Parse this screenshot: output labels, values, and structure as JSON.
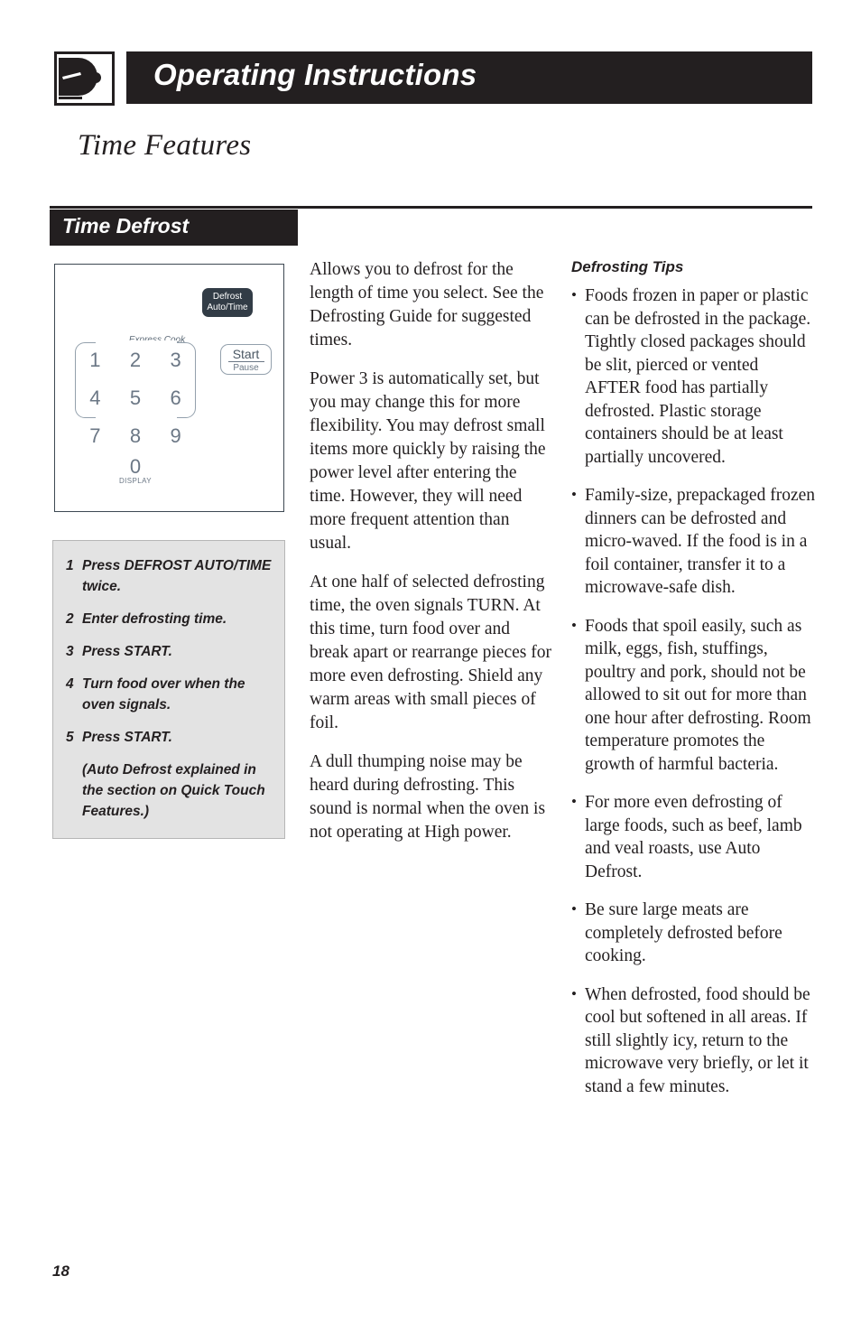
{
  "header": {
    "icon": "microwave-door-icon",
    "title": "Operating Instructions"
  },
  "page_heading": "Time Features",
  "section": {
    "label": "Time Defrost"
  },
  "control_panel": {
    "defrost_key": {
      "line1": "Defrost",
      "line2": "Auto/Time"
    },
    "express_cook_label": "Express Cook",
    "keypad_rows": [
      [
        "1",
        "2",
        "3"
      ],
      [
        "4",
        "5",
        "6"
      ],
      [
        "7",
        "8",
        "9"
      ]
    ],
    "zero_key": "0",
    "display_label": "DISPLAY",
    "start_key": {
      "line1": "Start",
      "line2": "Pause"
    }
  },
  "steps": [
    {
      "num": "1",
      "text": "Press DEFROST AUTO/TIME twice."
    },
    {
      "num": "2",
      "text": "Enter defrosting time."
    },
    {
      "num": "3",
      "text": "Press START."
    },
    {
      "num": "4",
      "text": "Turn food over when the oven signals."
    },
    {
      "num": "5",
      "text": "Press START."
    }
  ],
  "steps_note": "(Auto Defrost explained in the section on Quick Touch Features.)",
  "body_paragraphs": [
    "Allows you to defrost for the length of time you select. See the Defrosting Guide for suggested times.",
    "Power 3 is automatically set, but you may change this for more flexibility. You may defrost small items more quickly by raising the power level after entering the time. However, they will need more frequent attention than usual.",
    "At one half of selected defrosting time, the oven signals TURN. At this time, turn food over and break apart or rearrange pieces for more even defrosting. Shield any warm areas with small pieces of foil.",
    "A dull thumping noise may be heard during defrosting. This sound is normal when the oven is not operating at High power."
  ],
  "tips": {
    "title": "Defrosting Tips",
    "bullet_glyph": "•",
    "items": [
      "Foods frozen in paper or plastic can be defrosted in the package. Tightly closed packages should be slit, pierced or vented AFTER food has partially defrosted. Plastic storage containers should be at least partially uncovered.",
      "Family-size, prepackaged frozen dinners can be defrosted and micro-waved. If the food is in a foil container, transfer it to a microwave-safe dish.",
      "Foods that spoil easily, such as milk, eggs, fish, stuffings, poultry and pork, should not be allowed to sit out for more than one hour after defrosting. Room temperature promotes the growth of harmful bacteria.",
      "For more even defrosting of large foods, such as beef, lamb and veal roasts, use Auto Defrost.",
      "Be sure large meats are completely defrosted before cooking.",
      "When defrosted, food should be cool but softened in all areas. If still slightly icy, return to the microwave very briefly, or let it stand a few minutes."
    ]
  },
  "page_number": "18",
  "colors": {
    "ink": "#231f20",
    "panel_line": "#93a0ac",
    "digit": "#6b7785",
    "key_dark": "#323c46",
    "box_fill": "#e3e3e3"
  }
}
